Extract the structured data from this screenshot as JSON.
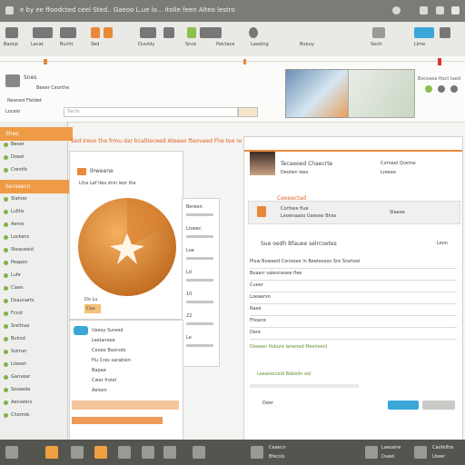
{
  "window": {
    "title": "e  by    ee   ffoodcted  ceel   Sted.. Gaeoo  L.ue  lo...   itolle  feen   Alteo  lestro",
    "controls": [
      "minimize",
      "maximize",
      "close"
    ]
  },
  "toolbar": {
    "groups": [
      "Baoop",
      "Lacat",
      "Bucht",
      "Sed",
      "Duutdy",
      "Snce",
      "Peiclace",
      "Laoolng",
      "Bueuy",
      "Sectr",
      "Llme"
    ],
    "accent": "#e8893a",
    "green": "#8cbf4c"
  },
  "infostrip": {
    "app_label": "Snes",
    "lines": [
      "Beeer  Ceorthe",
      "Neaned   Fleldet",
      "Gueecelt",
      "Bxceaea   ftoct   taed"
    ],
    "field_value": "Locaio",
    "search_placeholder": "Sechr"
  },
  "sidebar": {
    "header": "Shes",
    "highlight": "Serasecn",
    "items": [
      "Beeer",
      "Doeel",
      "Crentfs",
      "Slahrer",
      "Lulltis",
      "Aeme",
      "Lockens",
      "Steaceeid",
      "Peapen",
      "Lufe",
      "Ciaes",
      "Dsaunarts",
      "Fccol",
      "Sreltnas",
      "Bulrsd",
      "Ssirnar",
      "Lteeeh",
      "Ganvear",
      "Soseeda",
      "Aensebrs",
      "Chomds"
    ]
  },
  "center": {
    "headline": "Sed   Ireoo the  frmu dar bcaltieceed  Ateeeo  fteoveed  Fhe  tee  nec",
    "card_title": "Ilrweene",
    "card_subtitle": "Lfce  Lef ltes shin  ieor  ltie",
    "badge": "Cou",
    "caption": "Do  Lu",
    "list_rows": [
      "Ueesy  Sureed",
      "Leelaneee",
      "Ceooo  Baorsds",
      "Fiu  Cres  sarabien",
      "Bapae",
      "Cwer  frolel",
      "Aelsen"
    ],
    "values": [
      "Bereen",
      "Ltoeec",
      "Loe",
      "Ld",
      "10",
      "22",
      "Le"
    ]
  },
  "right": {
    "profile_name": "Tecaeoed  Chaecrte",
    "profile_lines": [
      "Corneel  Qustne",
      "Deolwn   Iees",
      "Lreeee"
    ],
    "section_title": "Ceoeectad",
    "section_lines": [
      "Corfoee   flue",
      "Leoenaaoo   Uaeoxe  Bhes",
      "Slaeee"
    ],
    "subheading": "Sue  oedh    Bfauee  selrcoetes",
    "note": "Leon",
    "rows": [
      "Plow  Boweed  Conooee ln  Beeteseso  Sre  Srarteel",
      "Boaarr  saleoceoee  flee",
      "Cueer",
      "Loeaersn",
      "Raee",
      "Fhoece",
      "Dere"
    ],
    "green_text": "Doeeen  fisbure  lerwned  Meslreenl",
    "green_text_2": "Leearecceld  Bobeiln   ool",
    "footer_label": "Deer"
  },
  "taskbar": {
    "tray": [
      "Ceaecn",
      "Bfecsls",
      "Laeuene",
      "Dueel",
      "Lbeer"
    ],
    "clock": "Caofelfos"
  }
}
